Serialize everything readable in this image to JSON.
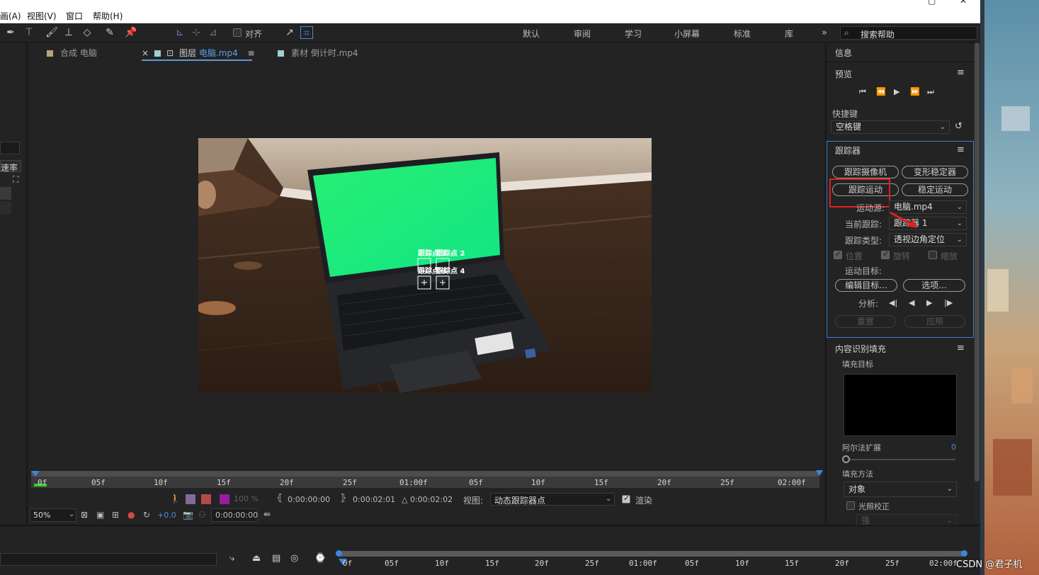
{
  "menubar": {
    "items": [
      "画(A)",
      "视图(V)",
      "窗口",
      "帮助(H)"
    ]
  },
  "toolbar": {
    "align_label": "对齐",
    "workspaces": [
      "默认",
      "审阅",
      "学习",
      "小屏幕",
      "标准",
      "库"
    ],
    "more": "»",
    "search_placeholder": "搜索帮助"
  },
  "left_panel": {
    "speed_label": "速率"
  },
  "viewer": {
    "tabs": [
      {
        "label": "合成 电脑",
        "color": "#b8a27c"
      },
      {
        "prefix": "图层",
        "label": "电脑.mp4",
        "color": "#9fcfd0"
      },
      {
        "label": "素材 倒计时.mp4",
        "color": "#9fcfd0"
      }
    ],
    "close": "×",
    "lock": "🔓",
    "menu": "≡",
    "track_points": [
      "跟踪点 1",
      "跟踪点 2",
      "跟踪点 3",
      "跟踪点 4"
    ],
    "ruler_labels": [
      "0f",
      "05f",
      "10f",
      "15f",
      "20f",
      "25f",
      "01:00f",
      "05f",
      "10f",
      "15f",
      "20f",
      "25f",
      "02:00f"
    ],
    "footer": {
      "quality": "100 %",
      "in_time": "0:00:00:00",
      "out_time": "0:00:02:01",
      "duration": "△ 0:00:02:02",
      "view_label": "视图:",
      "view_value": "动态跟踪器点",
      "render_label": "渲染",
      "zoom": "50%",
      "exposure": "+0.0",
      "current_time": "0:00:00:00"
    }
  },
  "right_panel": {
    "info_title": "信息",
    "preview_title": "预览",
    "shortcut_label": "快捷键",
    "shortcut_value": "空格键",
    "tracker": {
      "title": "跟踪器",
      "track_camera": "跟踪摄像机",
      "warp_stabilizer": "变形稳定器",
      "track_motion": "跟踪运动",
      "stabilize_motion": "稳定运动",
      "motion_source_label": "运动源:",
      "motion_source_value": "电脑.mp4",
      "current_track_label": "当前跟踪:",
      "current_track_value": "跟踪器 1",
      "track_type_label": "跟踪类型:",
      "track_type_value": "透视边角定位",
      "position": "位置",
      "rotation": "旋转",
      "scale": "缩放",
      "motion_target_label": "运动目标:",
      "edit_target": "编辑目标...",
      "options": "选项...",
      "analyze_label": "分析:",
      "reset": "重置",
      "apply": "应用"
    },
    "content_fill": {
      "title": "内容识别填充",
      "fill_target_label": "填充目标",
      "alpha_label": "阿尔法扩展",
      "alpha_value": "0",
      "method_label": "填充方法",
      "method_value": "对象",
      "lighting_label": "光照校正",
      "strength_value": "强"
    }
  },
  "timeline": {
    "ruler_labels": [
      "0f",
      "05f",
      "10f",
      "15f",
      "20f",
      "25f",
      "01:00f",
      "05f",
      "10f",
      "15f",
      "20f",
      "25f",
      "02:00f"
    ]
  },
  "watermark": "CSDN @君子机"
}
